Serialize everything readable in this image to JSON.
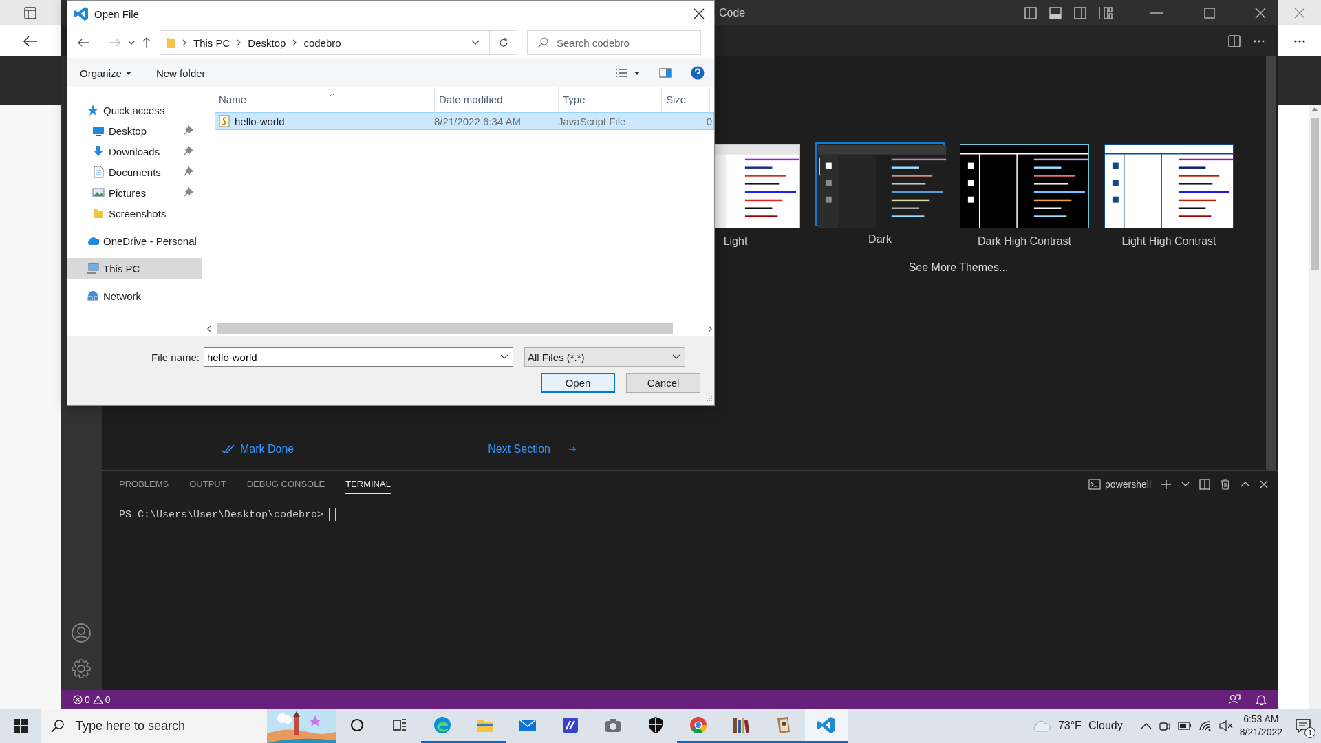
{
  "vscode": {
    "title": "Code",
    "themes": [
      {
        "label": "Light",
        "selected": false
      },
      {
        "label": "Dark",
        "selected": true
      },
      {
        "label": "Dark High Contrast",
        "selected": false
      },
      {
        "label": "Light High Contrast",
        "selected": false
      }
    ],
    "see_more": "See More Themes...",
    "mark_done": "Mark Done",
    "next_section": "Next Section",
    "panel": {
      "tabs": [
        {
          "label": "PROBLEMS",
          "selected": false
        },
        {
          "label": "OUTPUT",
          "selected": false
        },
        {
          "label": "DEBUG CONSOLE",
          "selected": false
        },
        {
          "label": "TERMINAL",
          "selected": true
        }
      ],
      "terminal_profile": "powershell",
      "prompt": "PS C:\\Users\\User\\Desktop\\codebro>"
    },
    "status_bar": {
      "errors": "0",
      "warnings": "0"
    }
  },
  "dialog": {
    "title": "Open File",
    "breadcrumb": [
      "This PC",
      "Desktop",
      "codebro"
    ],
    "search": {
      "placeholder": "Search codebro"
    },
    "commands": [
      "Organize",
      "New folder"
    ],
    "nav": [
      {
        "label": "Quick access",
        "selected": false,
        "children": [
          {
            "label": "Desktop",
            "pinned": true,
            "selected": false
          },
          {
            "label": "Downloads",
            "pinned": true,
            "selected": false
          },
          {
            "label": "Documents",
            "pinned": true,
            "selected": false
          },
          {
            "label": "Pictures",
            "pinned": true,
            "selected": false
          },
          {
            "label": "Screenshots",
            "pinned": false,
            "selected": false
          }
        ]
      },
      {
        "label": "OneDrive - Personal",
        "selected": false
      },
      {
        "label": "This PC",
        "selected": true
      },
      {
        "label": "Network",
        "selected": false
      }
    ],
    "columns": [
      "Name",
      "Date modified",
      "Type",
      "Size"
    ],
    "files": [
      {
        "name": "hello-world",
        "date": "8/21/2022 6:34 AM",
        "type": "JavaScript File",
        "size": "0",
        "selected": true
      }
    ],
    "file_name_label": "File name:",
    "file_name": "hello-world",
    "filter": "All Files (*.*)",
    "buttons": [
      {
        "label": "Open",
        "default": true
      },
      {
        "label": "Cancel",
        "default": false
      }
    ]
  },
  "taskbar": {
    "search": {
      "placeholder": "Type here to search"
    },
    "apps": [
      {
        "running": true,
        "selected": false
      },
      {
        "running": true,
        "selected": false
      },
      {
        "running": false,
        "selected": false
      },
      {
        "running": false,
        "selected": false
      },
      {
        "running": false,
        "selected": false
      },
      {
        "running": false,
        "selected": false
      },
      {
        "running": true,
        "selected": false
      },
      {
        "running": true,
        "selected": false
      },
      {
        "running": true,
        "selected": false
      },
      {
        "running": true,
        "selected": true
      }
    ],
    "temperature": "73°F",
    "weather": "Cloudy",
    "time": "6:53 AM",
    "date": "8/21/2022",
    "notifications": "1"
  }
}
